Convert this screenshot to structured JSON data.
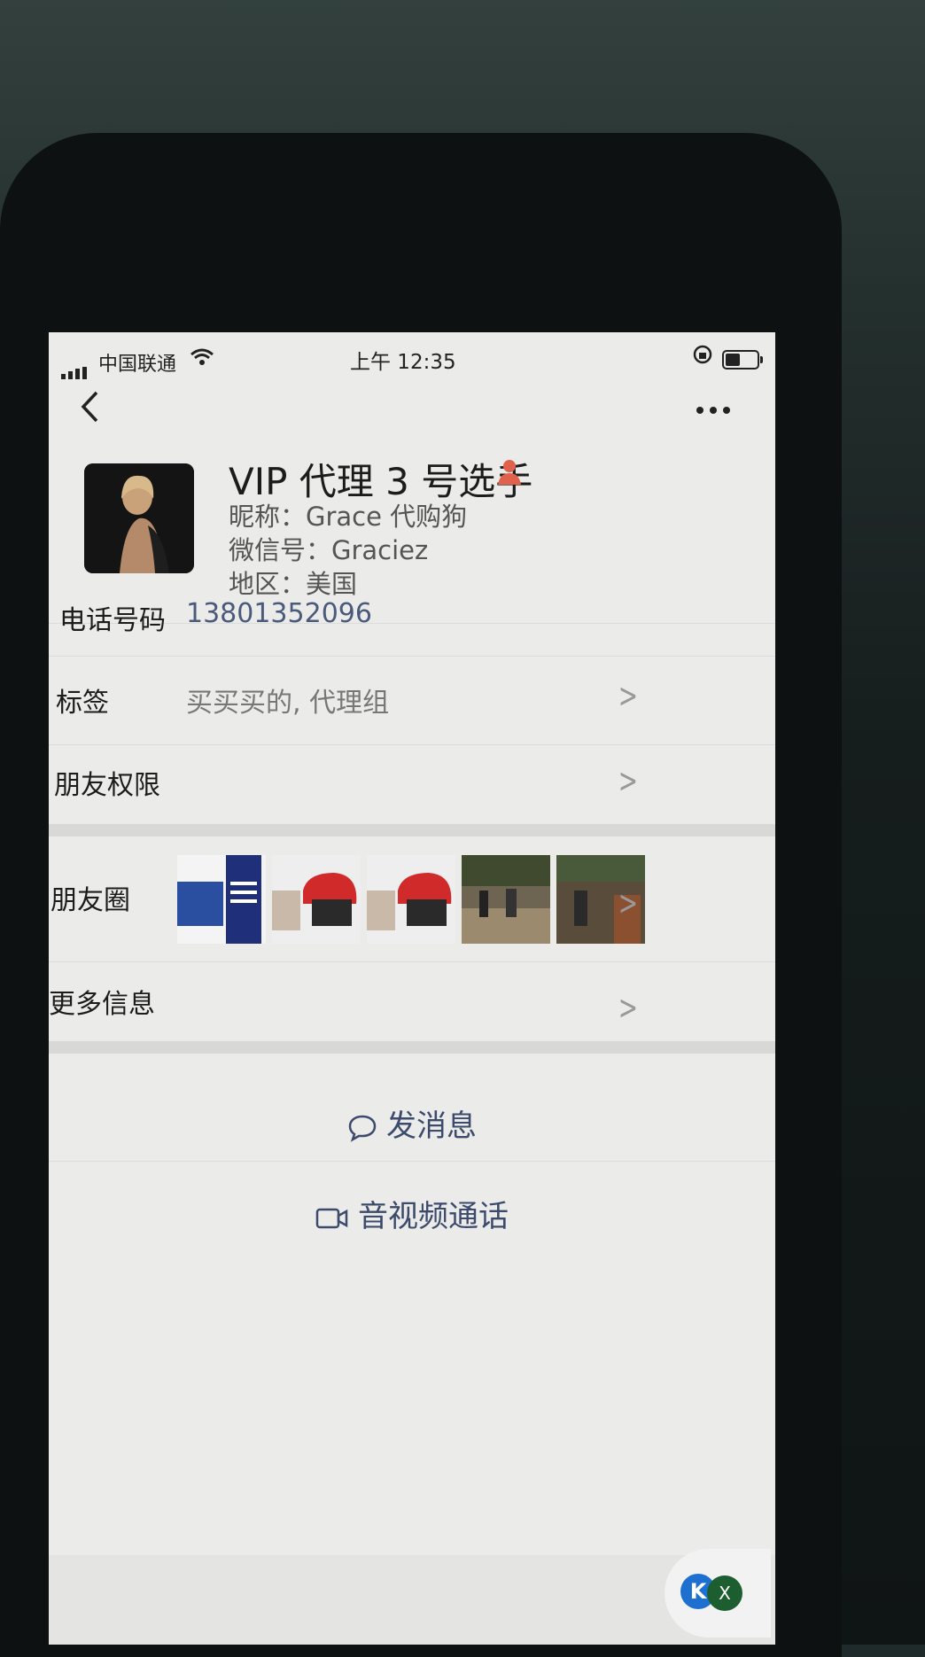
{
  "status_bar": {
    "carrier": "中国联通",
    "time": "上午 12:35"
  },
  "profile": {
    "display_name": "VIP 代理 3 号选手",
    "nickname": "昵称：Grace 代购狗",
    "wechat_id": "微信号：Graciez",
    "region": "地区：美国"
  },
  "rows": {
    "phone_label": "电话号码",
    "phone_value": "13801352096",
    "tags_label": "标签",
    "tags_value": "买买买的, 代理组",
    "permissions_label": "朋友权限",
    "moments_label": "朋友圈",
    "more_info_label": "更多信息"
  },
  "actions": {
    "send_message": "发消息",
    "video_call": "音视频通话"
  },
  "colors": {
    "link_blue": "#3c4a6b",
    "phone_value": "#4a5a7a",
    "person_icon": "#e0614c"
  },
  "icons": {
    "back": "chevron-left-icon",
    "more": "ellipsis-icon",
    "chat": "chat-bubble-icon",
    "video": "video-camera-icon"
  }
}
